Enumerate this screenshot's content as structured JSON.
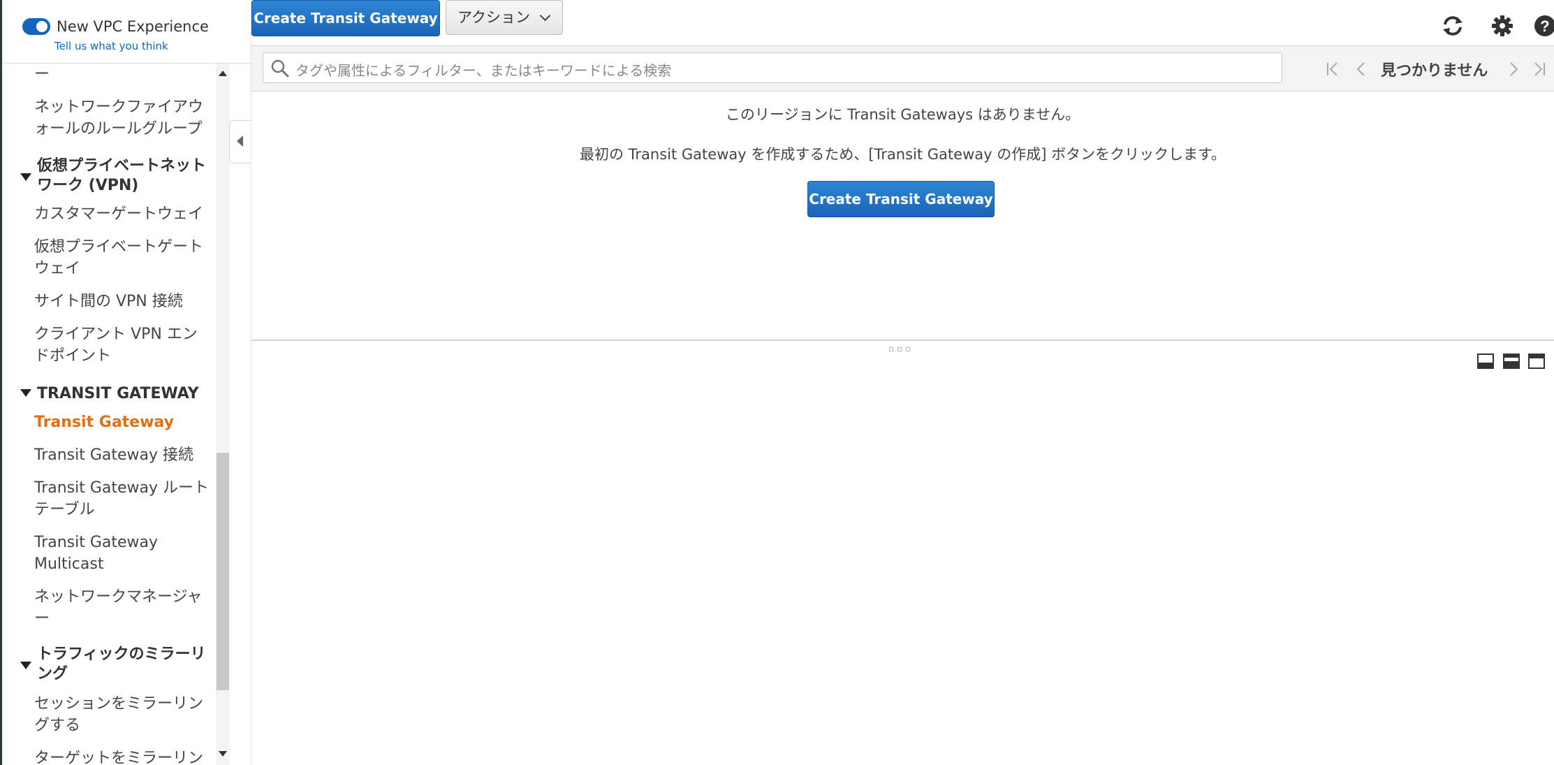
{
  "header": {
    "toggle_label": "New VPC Experience",
    "feedback_link": "Tell us what you think"
  },
  "sidebar": {
    "items": [
      {
        "label": "ー"
      },
      {
        "label": "ネットワークファイアウォールのルールグループ"
      },
      {
        "label": "仮想プライベートネットワーク (VPN)"
      },
      {
        "label": "カスタマーゲートウェイ"
      },
      {
        "label": "仮想プライベートゲートウェイ"
      },
      {
        "label": "サイト間の VPN 接続"
      },
      {
        "label": "クライアント VPN エンドポイント"
      },
      {
        "label": "TRANSIT GATEWAY"
      },
      {
        "label": "Transit Gateway"
      },
      {
        "label": "Transit Gateway 接続"
      },
      {
        "label": "Transit Gateway ルートテーブル"
      },
      {
        "label": "Transit Gateway Multicast"
      },
      {
        "label": "ネットワークマネージャー"
      },
      {
        "label": "トラフィックのミラーリング"
      },
      {
        "label": "セッションをミラーリングする"
      },
      {
        "label": "ターゲットをミラーリン"
      }
    ],
    "active_item": "Transit Gateway"
  },
  "toolbar": {
    "create_label": "Create Transit Gateway",
    "actions_label": "アクション"
  },
  "filter": {
    "placeholder": "タグや属性によるフィルター、またはキーワードによる検索",
    "pager_status": "見つかりません"
  },
  "empty_state": {
    "title": "このリージョンに Transit Gateways はありません。",
    "hint": "最初の Transit Gateway を作成するため、[Transit Gateway の作成] ボタンをクリックします。",
    "create_label": "Create Transit Gateway"
  },
  "icons": {
    "toolbar": [
      "refresh-icon",
      "gear-icon",
      "help-icon"
    ],
    "pager": [
      "first-page-icon",
      "previous-page-icon",
      "next-page-icon",
      "last-page-icon"
    ],
    "layout": [
      "layout-bottom-icon",
      "layout-split-icon",
      "layout-top-icon"
    ]
  },
  "colors": {
    "primary_button": "#1a64b8",
    "active_nav": "#e07010",
    "toggle_on": "#1166bb"
  }
}
